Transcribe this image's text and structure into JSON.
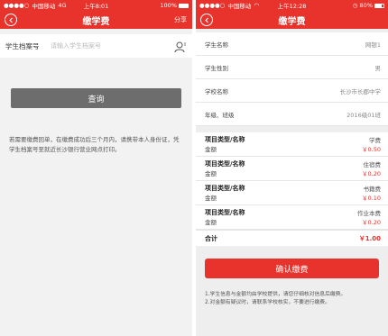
{
  "left": {
    "status": {
      "carrier": "中国移动",
      "network": "4G",
      "time": "上午8:01",
      "battery": "100%"
    },
    "nav": {
      "title": "缴学费",
      "share": "分享"
    },
    "input": {
      "label": "学生档案号",
      "placeholder": "请输入学生档案号"
    },
    "query_button": "查询",
    "notice": "若需要缴费回单，在缴费成功后三个月内，请携带本人身份证，凭学生档案号至就近长沙银行营业网点打印。"
  },
  "right": {
    "status": {
      "carrier": "中国移动",
      "time": "上午12:28",
      "battery": "80%"
    },
    "nav": {
      "title": "缴学费"
    },
    "info": [
      {
        "label": "学生名称",
        "value": "网银1"
      },
      {
        "label": "学生性别",
        "value": "男"
      },
      {
        "label": "学校名称",
        "value": "长沙市长郡中学"
      },
      {
        "label": "年级、班级",
        "value": "2016级01班"
      }
    ],
    "fees": [
      {
        "type_label": "项目类型/名称",
        "name": "学费",
        "amount_label": "金额",
        "amount": "￥0.50"
      },
      {
        "type_label": "项目类型/名称",
        "name": "住宿费",
        "amount_label": "金额",
        "amount": "￥0.20"
      },
      {
        "type_label": "项目类型/名称",
        "name": "书籍费",
        "amount_label": "金额",
        "amount": "￥0.10"
      },
      {
        "type_label": "项目类型/名称",
        "name": "作业本费",
        "amount_label": "金额",
        "amount": "￥0.20"
      }
    ],
    "total": {
      "label": "合计",
      "amount": "￥1.00"
    },
    "confirm_button": "确认缴费",
    "notes": [
      "1.学生信息与金额均由学校提供，请您仔细核对信息后缴费。",
      "2.对金额有疑议时，请联系学校核实，不要进行缴费。"
    ]
  },
  "colors": {
    "brand_red": "#e8322c",
    "query_gray": "#6d6d6d"
  }
}
